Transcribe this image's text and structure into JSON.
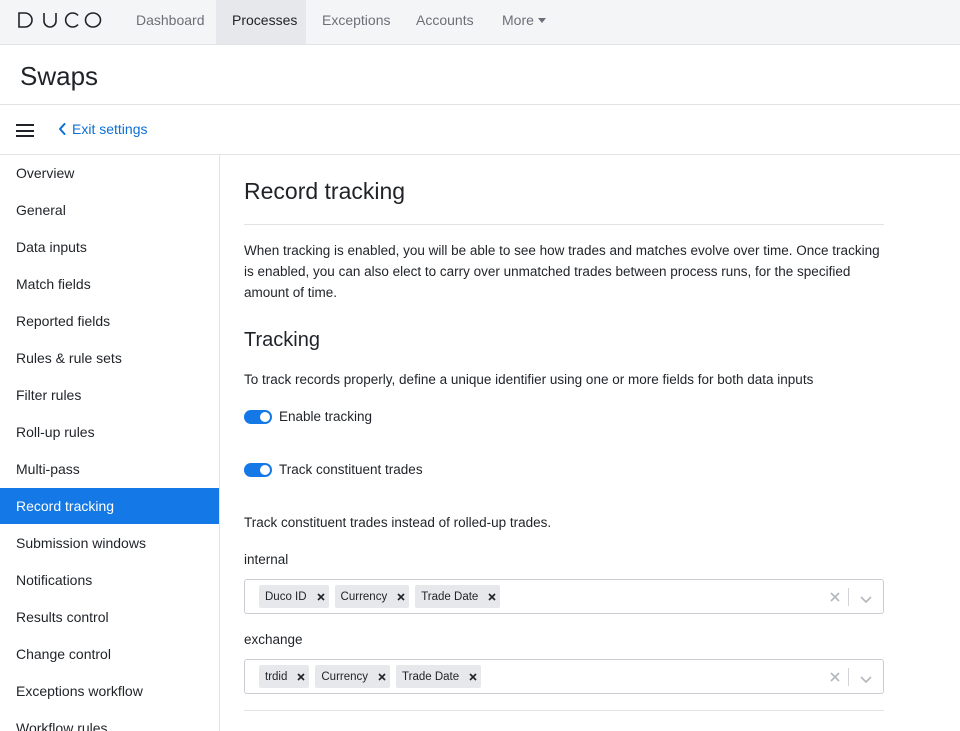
{
  "app": {
    "logo_text": "DUCO",
    "nav": [
      {
        "label": "Dashboard"
      },
      {
        "label": "Processes"
      },
      {
        "label": "Exceptions"
      },
      {
        "label": "Accounts"
      },
      {
        "label": "More"
      }
    ]
  },
  "page": {
    "title": "Swaps"
  },
  "settings_bar": {
    "exit_label": "Exit settings",
    "menu_icon": "hamburger-icon",
    "back_icon": "chevron-left-icon"
  },
  "sidebar": {
    "items": [
      {
        "label": "Overview"
      },
      {
        "label": "General"
      },
      {
        "label": "Data inputs"
      },
      {
        "label": "Match fields"
      },
      {
        "label": "Reported fields"
      },
      {
        "label": "Rules & rule sets"
      },
      {
        "label": "Filter rules"
      },
      {
        "label": "Roll-up rules"
      },
      {
        "label": "Multi-pass"
      },
      {
        "label": "Record tracking",
        "active": true
      },
      {
        "label": "Submission windows"
      },
      {
        "label": "Notifications"
      },
      {
        "label": "Results control"
      },
      {
        "label": "Change control"
      },
      {
        "label": "Exceptions workflow"
      },
      {
        "label": "Workflow rules"
      }
    ]
  },
  "content": {
    "heading": "Record tracking",
    "description": "When tracking is enabled, you will be able to see how trades and matches evolve over time. Once tracking is enabled, you can also elect to carry over unmatched trades between process runs, for the specified amount of time.",
    "tracking": {
      "heading": "Tracking",
      "instructions": "To track records properly, define a unique identifier using one or more fields for both data inputs",
      "enable_tracking": {
        "label": "Enable tracking",
        "on": true
      },
      "track_constituent": {
        "label": "Track constituent trades",
        "on": true
      },
      "constituent_note": "Track constituent trades instead of rolled-up trades."
    },
    "inputs": [
      {
        "label": "internal",
        "fields": [
          "Duco ID",
          "Currency",
          "Trade Date"
        ]
      },
      {
        "label": "exchange",
        "fields": [
          "trdid",
          "Currency",
          "Trade Date"
        ]
      }
    ]
  },
  "colors": {
    "accent": "#1478e6",
    "link": "#0b6fd6",
    "nav_bg": "#f4f5f7",
    "chip_bg": "#e6e8eb"
  }
}
